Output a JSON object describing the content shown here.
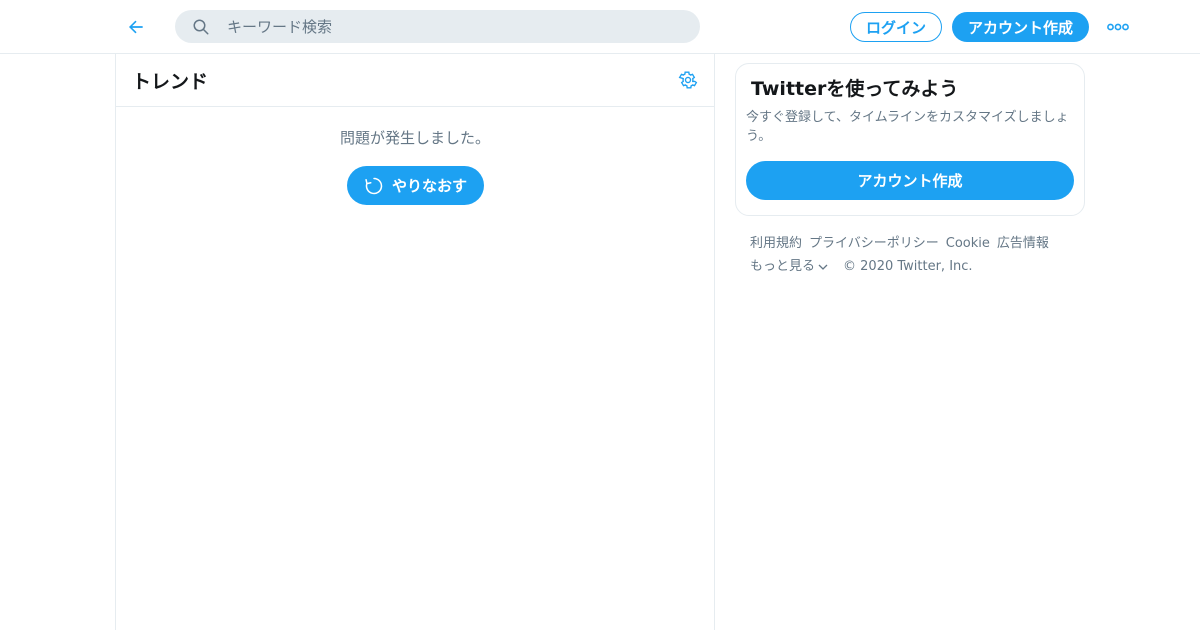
{
  "topbar": {
    "back_icon": "arrow-left-icon",
    "search": {
      "icon": "search-icon",
      "placeholder": "キーワード検索",
      "value": ""
    },
    "login_label": "ログイン",
    "signup_label": "アカウント作成",
    "more_icon": "more-dots-icon"
  },
  "main": {
    "title": "トレンド",
    "settings_icon": "gear-icon",
    "error_message": "問題が発生しました。",
    "retry_label": "やりなおす",
    "retry_icon": "refresh-icon"
  },
  "sidebar": {
    "card_title": "Twitterを使ってみよう",
    "card_description": "今すぐ登録して、タイムラインをカスタマイズしましょう。",
    "signup_label": "アカウント作成"
  },
  "footer": {
    "links": [
      "利用規約",
      "プライバシーポリシー",
      "Cookie",
      "広告情報"
    ],
    "more_label": "もっと見る",
    "copyright": "© 2020 Twitter, Inc."
  },
  "colors": {
    "accent": "#1da1f2",
    "border": "#e6ecf0",
    "secondary_text": "#657786",
    "primary_text": "#14171a"
  }
}
